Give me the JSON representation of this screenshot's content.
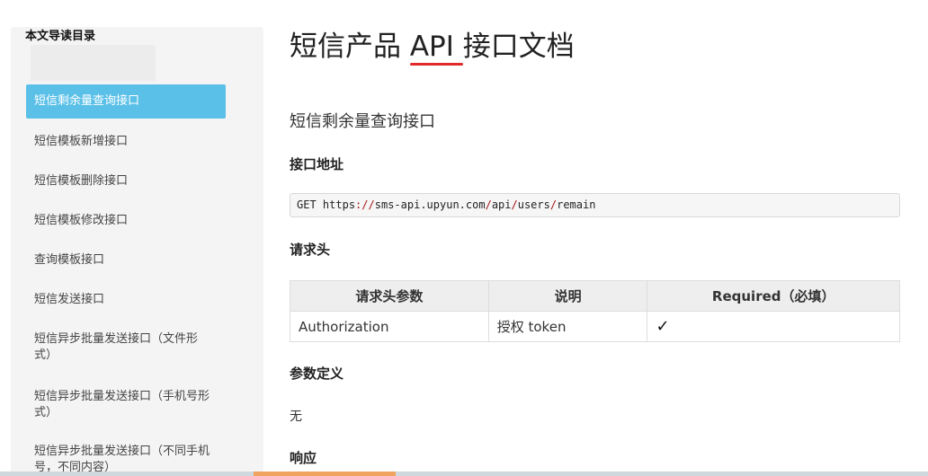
{
  "sidebar": {
    "title": "本文导读目录",
    "items": [
      {
        "label": "短信剩余量查询接口",
        "active": true
      },
      {
        "label": "短信模板新增接口"
      },
      {
        "label": "短信模板删除接口"
      },
      {
        "label": "短信模板修改接口"
      },
      {
        "label": "查询模板接口"
      },
      {
        "label": "短信发送接口"
      },
      {
        "label": "短信异步批量发送接口（文件形式）"
      },
      {
        "label": "短信异步批量发送接口（手机号形式）"
      },
      {
        "label": "短信异步批量发送接口（不同手机号，不同内容）"
      }
    ]
  },
  "main": {
    "title": "短信产品 API 接口文档",
    "section_title": "短信剩余量查询接口",
    "address_heading": "接口地址",
    "request": {
      "method": "GET",
      "url": "https://sms-api.upyun.com/api/users/remain"
    },
    "headers_heading": "请求头",
    "headers_table": {
      "columns": [
        "请求头参数",
        "说明",
        "Required（必填）"
      ],
      "rows": [
        [
          "Authorization",
          "授权 token",
          "✓"
        ]
      ]
    },
    "params_heading": "参数定义",
    "params_value": "无",
    "response_heading": "响应"
  },
  "colors": {
    "active_nav": "#5bc0e8",
    "title_underline": "#e32a2a",
    "scroll_thumb": "#f0a35e"
  }
}
